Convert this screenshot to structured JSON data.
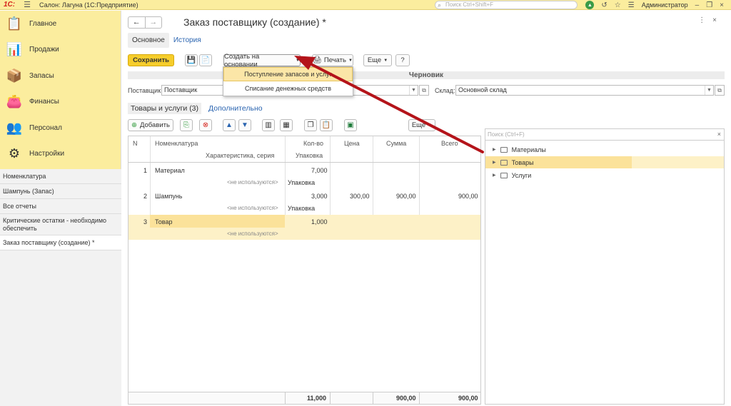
{
  "topbar": {
    "logo": "1С:",
    "app_title": "Салон: Лагуна  (1С:Предприятие)",
    "search_placeholder": "Поиск Ctrl+Shift+F",
    "user": "Администратор"
  },
  "sidebar": {
    "nav": [
      {
        "label": "Главное",
        "icon": "clipboard-icon"
      },
      {
        "label": "Продажи",
        "icon": "chart-icon"
      },
      {
        "label": "Запасы",
        "icon": "stock-icon"
      },
      {
        "label": "Финансы",
        "icon": "wallet-icon"
      },
      {
        "label": "Персонал",
        "icon": "people-icon"
      },
      {
        "label": "Настройки",
        "icon": "gear-icon"
      }
    ],
    "open_windows": [
      "Номенклатура",
      "Шампунь (Запас)",
      "Все отчеты",
      "Критические остатки - необходимо обеспечить",
      "Заказ поставщику (создание) *"
    ]
  },
  "header": {
    "title": "Заказ поставщику (создание) *",
    "tabs": [
      "Основное",
      "История"
    ]
  },
  "toolbar": {
    "save": "Сохранить",
    "create_based": "Создать на основании",
    "print": "Печать",
    "more": "Еще",
    "help": "?"
  },
  "dropdown": {
    "items": [
      "Поступление запасов и услуг",
      "Списание денежных средств"
    ]
  },
  "status": "Черновик",
  "form": {
    "supplier_label": "Поставщик:",
    "supplier_value": "Поставщик",
    "warehouse_label": "Склад:",
    "warehouse_value": "Основной склад"
  },
  "subtabs": [
    "Товары и услуги (3)",
    "Дополнительно"
  ],
  "table_toolbar": {
    "add": "Добавить",
    "more": "Еще"
  },
  "table": {
    "headers": {
      "n": "N",
      "item": "Номенклатура",
      "char": "Характеристика, серия",
      "qty": "Кол-во",
      "unit": "Упаковка",
      "price": "Цена",
      "sum": "Сумма",
      "total": "Всего"
    },
    "rows": [
      {
        "n": "1",
        "item": "Материал",
        "char": "<не используются>",
        "qty": "7,000",
        "unit": "Упаковка",
        "price": "",
        "sum": "",
        "total": ""
      },
      {
        "n": "2",
        "item": "Шампунь",
        "char": "<не используются>",
        "qty": "3,000",
        "unit": "Упаковка",
        "price": "300,00",
        "sum": "900,00",
        "total": "900,00"
      },
      {
        "n": "3",
        "item": "Товар",
        "char": "<не используются>",
        "qty": "1,000",
        "unit": "",
        "price": "",
        "sum": "",
        "total": ""
      }
    ],
    "footer": {
      "qty": "11,000",
      "sum": "900,00",
      "total": "900,00"
    }
  },
  "tree": {
    "search_placeholder": "Поиск (Ctrl+F)",
    "items": [
      "Материалы",
      "Товары",
      "Услуги"
    ]
  },
  "colors": {
    "accent_yellow": "#fbed9e",
    "save_button": "#f6cd2b",
    "highlight_row": "#fdf1c7",
    "arrow": "#b4141a"
  }
}
